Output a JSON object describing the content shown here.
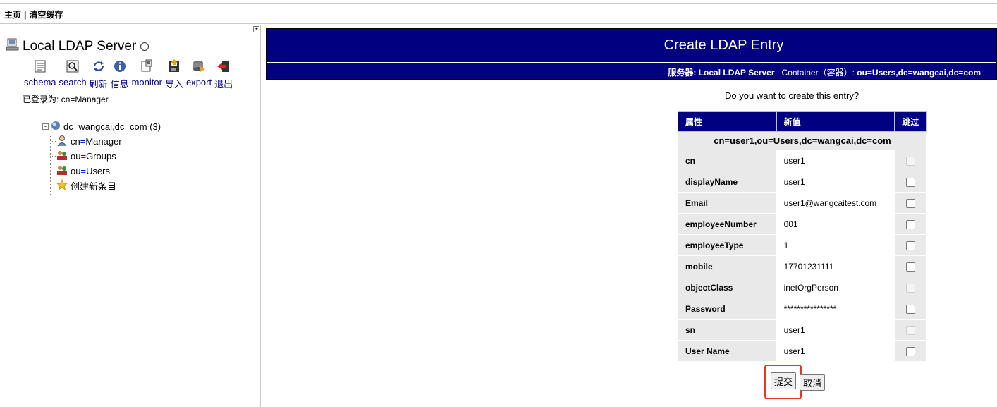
{
  "topbar": {
    "home": "主页",
    "separator": "|",
    "clear_cache": "清空缓存"
  },
  "sidebar": {
    "server_name": "Local LDAP Server",
    "toolbar": [
      {
        "label": "schema",
        "icon": "schema-icon"
      },
      {
        "label": "search",
        "icon": "search-icon"
      },
      {
        "label": "刷新",
        "icon": "refresh-icon"
      },
      {
        "label": "信息",
        "icon": "info-icon"
      },
      {
        "label": "monitor",
        "icon": "monitor-icon"
      },
      {
        "label": "导入",
        "icon": "import-icon"
      },
      {
        "label": "export",
        "icon": "export-icon"
      },
      {
        "label": "退出",
        "icon": "logout-icon"
      }
    ],
    "logged_in_label": "已登录为:",
    "logged_in_user": "cn=Manager",
    "tree": {
      "expander": "-",
      "root": {
        "a": "dc",
        "b": "wangcai",
        "comma": ",",
        "c": "dc",
        "d": "com",
        "count": "(3)"
      },
      "children": [
        {
          "attr": "cn",
          "value": "Manager"
        },
        {
          "attr": "ou",
          "value": "Groups"
        },
        {
          "attr": "ou",
          "value": "Users"
        }
      ],
      "create_new": "创建新条目"
    }
  },
  "main": {
    "title": "Create LDAP Entry",
    "server_label": "服务器:",
    "server_value": "Local LDAP Server",
    "container_label": "Container（容器）:",
    "container_value": "ou=Users,dc=wangcai,dc=com",
    "question": "Do you want to create this entry?",
    "headers": {
      "attribute": "属性",
      "new_value": "新值",
      "skip": "跳过"
    },
    "dn": "cn=user1,ou=Users,dc=wangcai,dc=com",
    "rows": [
      {
        "name": "cn",
        "value": "user1",
        "skip_enabled": false
      },
      {
        "name": "displayName",
        "value": "user1",
        "skip_enabled": true
      },
      {
        "name": "Email",
        "value": "user1@wangcaitest.com",
        "skip_enabled": true
      },
      {
        "name": "employeeNumber",
        "value": "001",
        "skip_enabled": true
      },
      {
        "name": "employeeType",
        "value": "1",
        "skip_enabled": true
      },
      {
        "name": "mobile",
        "value": "17701231111",
        "skip_enabled": true
      },
      {
        "name": "objectClass",
        "value": "inetOrgPerson",
        "skip_enabled": false
      },
      {
        "name": "Password",
        "value": "****************",
        "skip_enabled": true
      },
      {
        "name": "sn",
        "value": "user1",
        "skip_enabled": false
      },
      {
        "name": "User Name",
        "value": "user1",
        "skip_enabled": true
      }
    ],
    "submit_label": "提交",
    "cancel_label": "取消"
  }
}
